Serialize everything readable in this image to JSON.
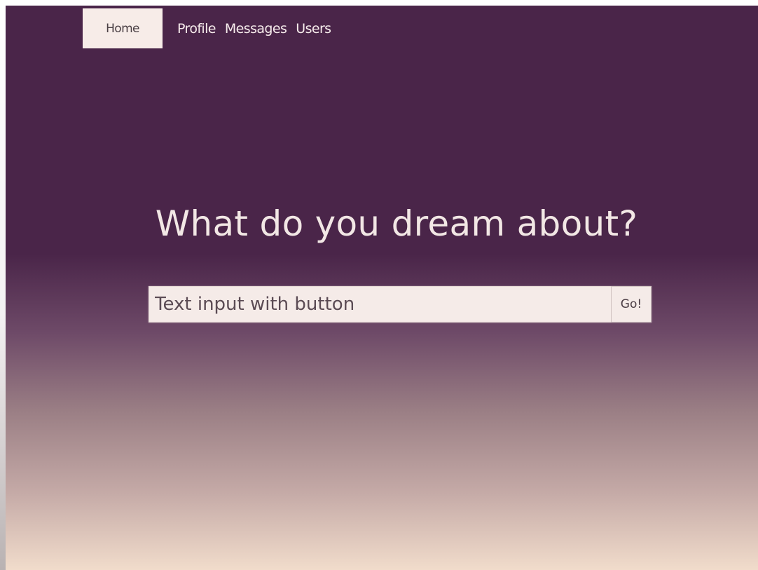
{
  "nav": {
    "items": [
      {
        "label": "Home",
        "active": true
      },
      {
        "label": "Profile",
        "active": false
      },
      {
        "label": "Messages",
        "active": false
      },
      {
        "label": "Users",
        "active": false
      }
    ]
  },
  "hero": {
    "title": "What do you dream about?"
  },
  "search": {
    "placeholder": "Text input with button",
    "button_label": "Go!"
  },
  "colors": {
    "background_top": "#4a2549",
    "background_bottom": "#f1dccb",
    "nav_active_bg": "#f7ece8",
    "text_light": "#f2e7e5"
  }
}
